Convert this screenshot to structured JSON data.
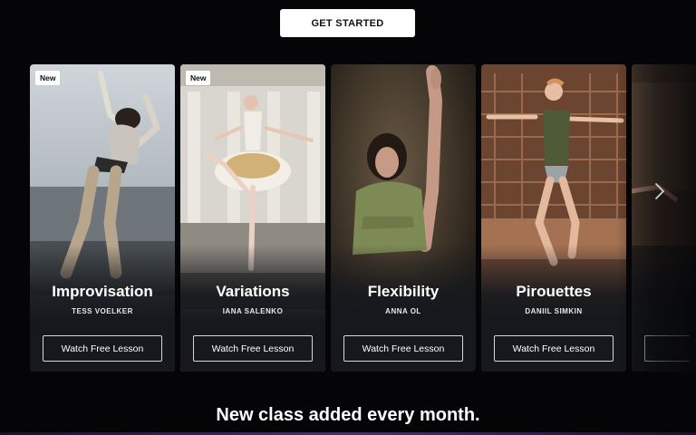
{
  "header": {
    "cta_label": "GET STARTED"
  },
  "cards": [
    {
      "badge": "New",
      "title": "Improvisation",
      "instructor": "TESS VOELKER",
      "button": "Watch Free Lesson"
    },
    {
      "badge": "New",
      "title": "Variations",
      "instructor": "IANA SALENKO",
      "button": "Watch Free Lesson"
    },
    {
      "badge": "",
      "title": "Flexibility",
      "instructor": "ANNA OL",
      "button": "Watch Free Lesson"
    },
    {
      "badge": "",
      "title": "Pirouettes",
      "instructor": "DANIIL SIMKIN",
      "button": "Watch Free Lesson"
    }
  ],
  "carousel": {
    "next_icon": "chevron-right-icon"
  },
  "footer": {
    "tagline": "New class added every month."
  }
}
